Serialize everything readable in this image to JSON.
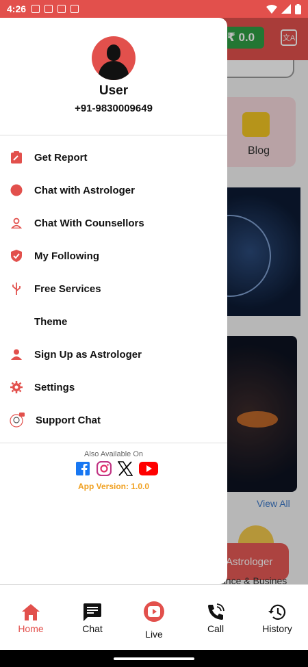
{
  "status_bar": {
    "time": "4:26"
  },
  "background": {
    "wallet": "₹ 0.0",
    "blog_label": "Blog",
    "view_all": "View All",
    "astrologer_button": "Astrologer",
    "caption": "ance & Busines"
  },
  "drawer": {
    "user_name": "User",
    "user_phone": "+91-9830009649",
    "menu": [
      {
        "label": "Get Report",
        "icon": "report-icon"
      },
      {
        "label": "Chat with Astrologer",
        "icon": "chat-astrologer-icon"
      },
      {
        "label": "Chat With Counsellors",
        "icon": "counsellor-icon"
      },
      {
        "label": "My Following",
        "icon": "shield-check-icon"
      },
      {
        "label": "Free Services",
        "icon": "usb-icon"
      },
      {
        "label": "Theme",
        "icon": "moon-icon"
      },
      {
        "label": "Sign Up as Astrologer",
        "icon": "person-icon"
      },
      {
        "label": "Settings",
        "icon": "gear-icon"
      },
      {
        "label": "Support Chat",
        "icon": "support-agent-icon"
      }
    ],
    "available_text": "Also Available On",
    "socials": [
      "facebook-icon",
      "instagram-icon",
      "x-icon",
      "youtube-icon"
    ],
    "app_version": "App Version: 1.0.0"
  },
  "bottom_nav": [
    {
      "label": "Home",
      "icon": "home-icon",
      "active": true
    },
    {
      "label": "Chat",
      "icon": "chat-icon",
      "active": false
    },
    {
      "label": "Live",
      "icon": "live-icon",
      "active": false
    },
    {
      "label": "Call",
      "icon": "call-icon",
      "active": false
    },
    {
      "label": "History",
      "icon": "history-icon",
      "active": false
    }
  ],
  "colors": {
    "primary": "#e2504c",
    "wallet": "#2f9e44",
    "version": "#f0a020"
  }
}
